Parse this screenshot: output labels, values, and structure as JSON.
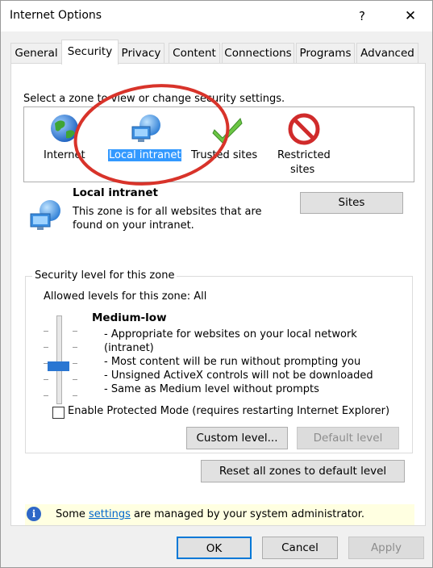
{
  "window": {
    "title": "Internet Options",
    "help": "?",
    "close": "✕"
  },
  "tabs": [
    "General",
    "Security",
    "Privacy",
    "Content",
    "Connections",
    "Programs",
    "Advanced"
  ],
  "zones": {
    "prompt": "Select a zone to view or change security settings.",
    "items": [
      {
        "label": "Internet",
        "icon": "globe-icon"
      },
      {
        "label": "Local intranet",
        "icon": "network-globe-icon"
      },
      {
        "label": "Trusted sites",
        "icon": "checkmark-icon"
      },
      {
        "label": "Restricted",
        "label2": "sites",
        "icon": "restricted-icon"
      }
    ]
  },
  "selected_zone": {
    "name": "Local intranet",
    "desc_line1": "This zone is for all websites that are",
    "desc_line2": "found on your intranet.",
    "sites_button": "Sites"
  },
  "security_level": {
    "group_title": "Security level for this zone",
    "allowed": "Allowed levels for this zone: All",
    "level_name": "Medium-low",
    "lines": [
      "- Appropriate for websites on your local network",
      "(intranet)",
      "- Most content will be run without prompting you",
      "- Unsigned ActiveX controls will not be downloaded",
      "- Same as Medium level without prompts"
    ],
    "protected_mode": "Enable Protected Mode (requires restarting Internet Explorer)",
    "protected_checked": false,
    "custom_level": "Custom level...",
    "default_level": "Default level"
  },
  "reset_all": "Reset all zones to default level",
  "info": {
    "prefix": "Some ",
    "link": "settings",
    "suffix": " are managed by your system administrator."
  },
  "buttons": {
    "ok": "OK",
    "cancel": "Cancel",
    "apply": "Apply"
  },
  "colors": {
    "selection": "#3399ff",
    "annotation_circle": "#d8332a",
    "thumb": "#2a76d2",
    "info_bar": "#ffffe1"
  }
}
